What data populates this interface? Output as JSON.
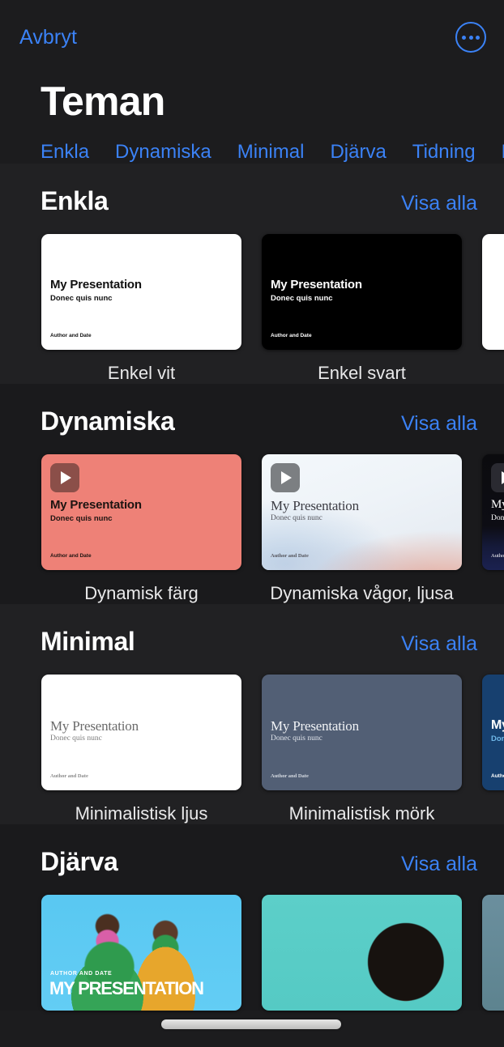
{
  "topbar": {
    "cancel_label": "Avbryt",
    "more_icon": "ellipsis-circle-icon"
  },
  "page_title": "Teman",
  "tabs": [
    {
      "label": "Enkla"
    },
    {
      "label": "Dynamiska"
    },
    {
      "label": "Minimal"
    },
    {
      "label": "Djärva"
    },
    {
      "label": "Tidning"
    },
    {
      "label": "Po"
    }
  ],
  "see_all_label": "Visa alla",
  "slide_text": {
    "title": "My Presentation",
    "subtitle": "Donec quis nunc",
    "author": "Author and Date",
    "bold_title": "MY PRESENTATION",
    "bold_author": "AUTHOR AND DATE"
  },
  "sections": [
    {
      "title": "Enkla",
      "see_all": "Visa alla",
      "themes": [
        {
          "name": "Enkel vit"
        },
        {
          "name": "Enkel svart"
        },
        {
          "name": ""
        }
      ]
    },
    {
      "title": "Dynamiska",
      "see_all": "Visa alla",
      "themes": [
        {
          "name": "Dynamisk färg"
        },
        {
          "name": "Dynamiska vågor, ljusa"
        },
        {
          "name": ""
        }
      ]
    },
    {
      "title": "Minimal",
      "see_all": "Visa alla",
      "themes": [
        {
          "name": "Minimalistisk ljus"
        },
        {
          "name": "Minimalistisk mörk"
        },
        {
          "name": ""
        }
      ]
    },
    {
      "title": "Djärva",
      "see_all": "Visa alla",
      "themes": [
        {
          "name": ""
        },
        {
          "name": ""
        },
        {
          "name": ""
        }
      ]
    }
  ],
  "colors": {
    "accent_blue": "#3b82f6",
    "background": "#1c1c1e",
    "section_alt": "#1a1a1c",
    "text_primary": "#ffffff",
    "coral": "#ee8177",
    "slate": "#525f75",
    "navy": "#17406f"
  }
}
